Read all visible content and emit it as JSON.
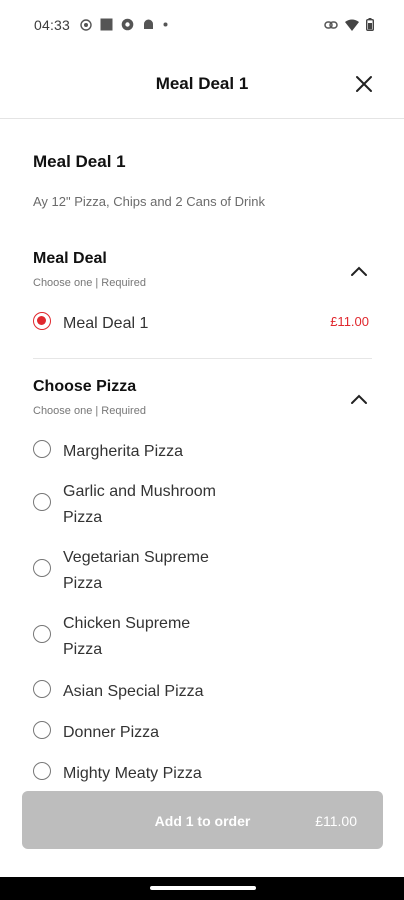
{
  "status_bar": {
    "time": "04:33",
    "left_icons": [
      "whatsapp-icon",
      "square-icon",
      "settings-icon",
      "android-icon",
      "dot-icon"
    ],
    "right_icons": [
      "link-icon",
      "wifi-icon",
      "battery-icon"
    ]
  },
  "header": {
    "title": "Meal Deal 1",
    "close_icon": "close-icon"
  },
  "item": {
    "title": "Meal Deal 1",
    "description": "Ay 12\" Pizza, Chips and 2 Cans of Drink"
  },
  "groups": [
    {
      "title": "Meal Deal",
      "subtitle": "Choose one  |  Required",
      "expanded": true,
      "options": [
        {
          "label": "Meal Deal 1",
          "price": "£11.00",
          "selected": true
        }
      ]
    },
    {
      "title": "Choose Pizza",
      "subtitle": "Choose one  |  Required",
      "expanded": true,
      "options": [
        {
          "label": "Margherita Pizza",
          "selected": false
        },
        {
          "label": "Garlic and Mushroom Pizza",
          "selected": false
        },
        {
          "label": "Vegetarian Supreme Pizza",
          "selected": false
        },
        {
          "label": "Chicken Supreme Pizza",
          "selected": false
        },
        {
          "label": "Asian Special Pizza",
          "selected": false
        },
        {
          "label": "Donner Pizza",
          "selected": false
        },
        {
          "label": "Mighty Meaty Pizza",
          "selected": false
        }
      ]
    }
  ],
  "footer": {
    "add_label": "Add 1 to order",
    "add_price": "£11.00"
  },
  "colors": {
    "accent": "#e0282e",
    "button_disabled": "#bdbdbd"
  }
}
